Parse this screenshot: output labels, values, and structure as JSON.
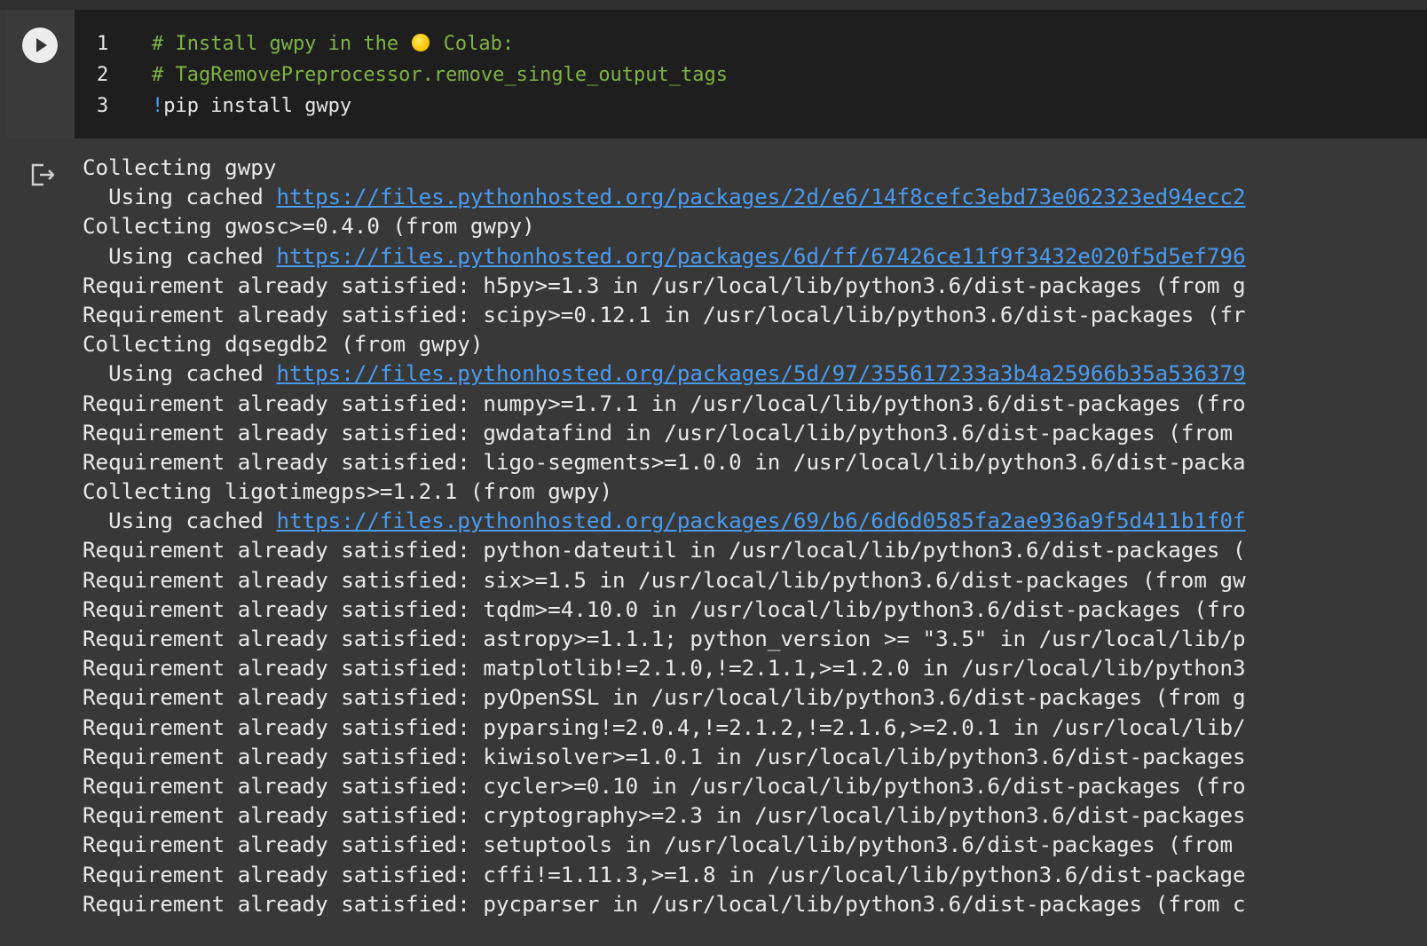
{
  "code_cell": {
    "lines": [
      {
        "number": "1",
        "segments": [
          {
            "type": "comment",
            "text": "# Install gwpy in the "
          },
          {
            "type": "emoji",
            "icon": "sun-emoji"
          },
          {
            "type": "comment",
            "text": " Colab:"
          }
        ]
      },
      {
        "number": "2",
        "segments": [
          {
            "type": "comment",
            "text": "# TagRemovePreprocessor.remove_single_output_tags"
          }
        ]
      },
      {
        "number": "3",
        "segments": [
          {
            "type": "bang",
            "text": "!"
          },
          {
            "type": "plain",
            "text": "pip install gwpy"
          }
        ]
      }
    ]
  },
  "output": {
    "icon": "output-clear-icon",
    "lines": [
      {
        "text": "Collecting gwpy"
      },
      {
        "text": "  Using cached ",
        "link": "https://files.pythonhosted.org/packages/2d/e6/14f8cefc3ebd73e062323ed94ecc2"
      },
      {
        "text": "Collecting gwosc>=0.4.0 (from gwpy)"
      },
      {
        "text": "  Using cached ",
        "link": "https://files.pythonhosted.org/packages/6d/ff/67426ce11f9f3432e020f5d5ef796"
      },
      {
        "text": "Requirement already satisfied: h5py>=1.3 in /usr/local/lib/python3.6/dist-packages (from g"
      },
      {
        "text": "Requirement already satisfied: scipy>=0.12.1 in /usr/local/lib/python3.6/dist-packages (fr"
      },
      {
        "text": "Collecting dqsegdb2 (from gwpy)"
      },
      {
        "text": "  Using cached ",
        "link": "https://files.pythonhosted.org/packages/5d/97/355617233a3b4a25966b35a536379"
      },
      {
        "text": "Requirement already satisfied: numpy>=1.7.1 in /usr/local/lib/python3.6/dist-packages (fro"
      },
      {
        "text": "Requirement already satisfied: gwdatafind in /usr/local/lib/python3.6/dist-packages (from"
      },
      {
        "text": "Requirement already satisfied: ligo-segments>=1.0.0 in /usr/local/lib/python3.6/dist-packa"
      },
      {
        "text": "Collecting ligotimegps>=1.2.1 (from gwpy)"
      },
      {
        "text": "  Using cached ",
        "link": "https://files.pythonhosted.org/packages/69/b6/6d6d0585fa2ae936a9f5d411b1f0f"
      },
      {
        "text": "Requirement already satisfied: python-dateutil in /usr/local/lib/python3.6/dist-packages ("
      },
      {
        "text": "Requirement already satisfied: six>=1.5 in /usr/local/lib/python3.6/dist-packages (from gw"
      },
      {
        "text": "Requirement already satisfied: tqdm>=4.10.0 in /usr/local/lib/python3.6/dist-packages (fro"
      },
      {
        "text": "Requirement already satisfied: astropy>=1.1.1; python_version >= \"3.5\" in /usr/local/lib/p"
      },
      {
        "text": "Requirement already satisfied: matplotlib!=2.1.0,!=2.1.1,>=1.2.0 in /usr/local/lib/python3"
      },
      {
        "text": "Requirement already satisfied: pyOpenSSL in /usr/local/lib/python3.6/dist-packages (from g"
      },
      {
        "text": "Requirement already satisfied: pyparsing!=2.0.4,!=2.1.2,!=2.1.6,>=2.0.1 in /usr/local/lib/"
      },
      {
        "text": "Requirement already satisfied: kiwisolver>=1.0.1 in /usr/local/lib/python3.6/dist-packages"
      },
      {
        "text": "Requirement already satisfied: cycler>=0.10 in /usr/local/lib/python3.6/dist-packages (fro"
      },
      {
        "text": "Requirement already satisfied: cryptography>=2.3 in /usr/local/lib/python3.6/dist-packages"
      },
      {
        "text": "Requirement already satisfied: setuptools in /usr/local/lib/python3.6/dist-packages (from "
      },
      {
        "text": "Requirement already satisfied: cffi!=1.11.3,>=1.8 in /usr/local/lib/python3.6/dist-package"
      },
      {
        "text": "Requirement already satisfied: pycparser in /usr/local/lib/python3.6/dist-packages (from c"
      }
    ]
  },
  "colors": {
    "comment": "#7fb347",
    "bang": "#4fa3ff",
    "link": "#4a9bf0",
    "cell_background": "#1e1e1e",
    "output_background": "#383838"
  }
}
